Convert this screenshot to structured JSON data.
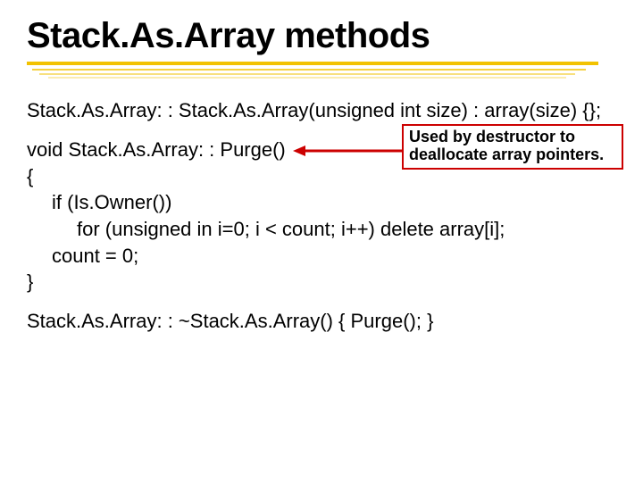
{
  "title": "Stack.As.Array methods",
  "code": {
    "ctor": "Stack.As.Array: : Stack.As.Array(unsigned int size) : array(size) {};",
    "purge_sig": "void Stack.As.Array: : Purge()",
    "brace_open": "{",
    "if_line": "if (Is.Owner())",
    "for_line": "for (unsigned in i=0; i < count; i++) delete array[i];",
    "count_line": "count = 0;",
    "brace_close": "}",
    "dtor": "Stack.As.Array: : ~Stack.As.Array() { Purge(); }"
  },
  "callout": {
    "line1": "Used by destructor to",
    "line2": "deallocate array pointers."
  },
  "colors": {
    "accent": "#f2c200",
    "callout_border": "#cc0000"
  }
}
